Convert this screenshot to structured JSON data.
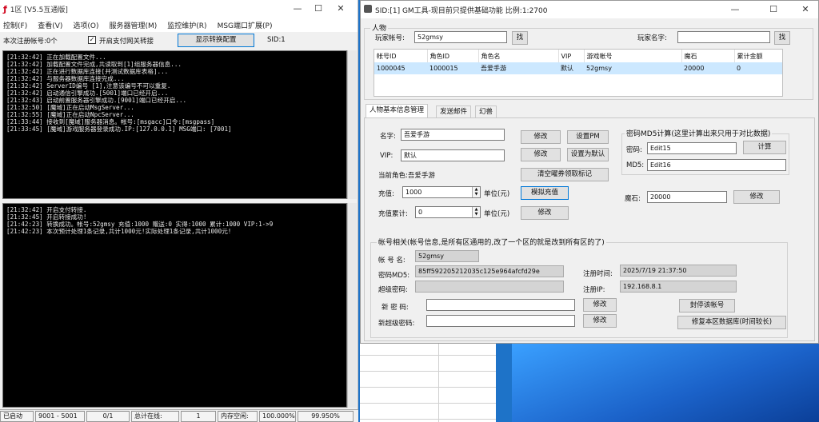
{
  "left": {
    "title": "1区 [V5.5互通版]",
    "menu": [
      "控制(F)",
      "查看(V)",
      "选项(O)",
      "服务器管理(M)",
      "监控维护(R)",
      "MSG端口扩展(P)"
    ],
    "toolbar": {
      "register_label": "本次注册帐号:0个",
      "gateway_checkbox": "开启支付网关转接",
      "show_config_button": "显示转换配置",
      "sid_label": "SID:1"
    },
    "log_top": [
      "[21:32:42] 正在加载配置文件...",
      "[21:32:42] 加载配置文件完成,共读取到[1]组服务器信息...",
      "[21:32:42] 正在进行数据库连接[并测试数据库表格]...",
      "[21:32:42] 与服务器数据库连接完成...",
      "[21:32:42] ServerID编号 [1],注意该编号不可以重复.",
      "[21:32:42] 启动通信引擎成功.[5001]端口已经开启...",
      "[21:32:43] 启动前置服务器引擎成功.[9001]端口已经开启...",
      "[21:32:50] [魔域]正在启动MsgServer...",
      "[21:32:55] [魔域]正在启动NpcServer...",
      "[21:33:44] 接收到[魔域]服务器消息。帐号:[msgacc]口令:[msgpass]",
      "[21:33:45] [魔域]游戏服务器登录成功.IP:[127.0.0.1] MSG端口: [7001]"
    ],
    "log_bottom": [
      "[21:32:42] 开启支付转接.",
      "[21:32:45] 开启转接成功!",
      "[21:42:23] 转换成功。帐号:52gmsy 充值:1000 赠送:0 实得:1000 累计:1000 VIP:1->9",
      "[21:42:23] 本次预计处理1条记录,共计1000元!实际处理1条记录,共计1000元!"
    ],
    "status": [
      "已启动",
      "9001 - 5001",
      "0/1",
      "总计在线:",
      "1",
      "内存空闲:",
      "100.000%",
      "99.950%"
    ]
  },
  "right": {
    "title": "SID:[1] GM工具-现目前只提供基础功能 比例:1:2700",
    "group_title": "人物",
    "player_account_label": "玩家帐号:",
    "player_account_value": "52gmsy",
    "search_button": "找",
    "player_name_label": "玩家名字:",
    "player_name_value": "",
    "table": {
      "headers": [
        "帐号ID",
        "角色ID",
        "角色名",
        "VIP",
        "游戏帐号",
        "魔石",
        "累计金额"
      ],
      "rows": [
        [
          "1000045",
          "1000015",
          "吾爱手游",
          "默认",
          "52gmsy",
          "20000",
          "0"
        ]
      ]
    },
    "tabs": [
      "人物基本信息管理",
      "发送邮件",
      "幻兽"
    ],
    "basic": {
      "name_label": "名字:",
      "name_value": "吾爱手游",
      "vip_label": "VIP:",
      "vip_value": "默认",
      "current_role": "当前角色:吾爱手游",
      "recharge_label": "充值:",
      "recharge_value": "1000",
      "unit_label": "单位(元)",
      "total_label": "充值累计:",
      "total_value": "0",
      "modify": "修改",
      "set_gm": "设置PM",
      "set_default": "设置为默认",
      "clear_coupon": "清空曜券领取标记",
      "simulate_recharge": "模拟充值"
    },
    "md5": {
      "title": "密码MD5计算(这里计算出来只用于对比数据)",
      "password_label": "密码:",
      "password_value": "Edit15",
      "calc_button": "计算",
      "md5_label": "MD5:",
      "md5_value": "Edit16"
    },
    "stone_label": "魔石:",
    "stone_value": "20000",
    "account": {
      "title": "帐号相关(帐号信息,是所有区通用的,改了一个区的就是改到所有区的了)",
      "account_label": "帐 号 名:",
      "account_value": "52gmsy",
      "pwdmd5_label": "密码MD5:",
      "pwdmd5_value": "85ff592205212035c125e964afcfd29e",
      "super_label": "超级密码:",
      "super_value": "",
      "reg_time_label": "注册时间:",
      "reg_time_value": "2025/7/19 21:37:50",
      "reg_ip_label": "注册IP:",
      "reg_ip_value": "192.168.8.1",
      "new_pwd_label": "新 密 码:",
      "new_super_label": "新超级密码:",
      "ban_button": "封停该帐号",
      "repair_button": "修复本区数据库(时间较长)"
    }
  }
}
